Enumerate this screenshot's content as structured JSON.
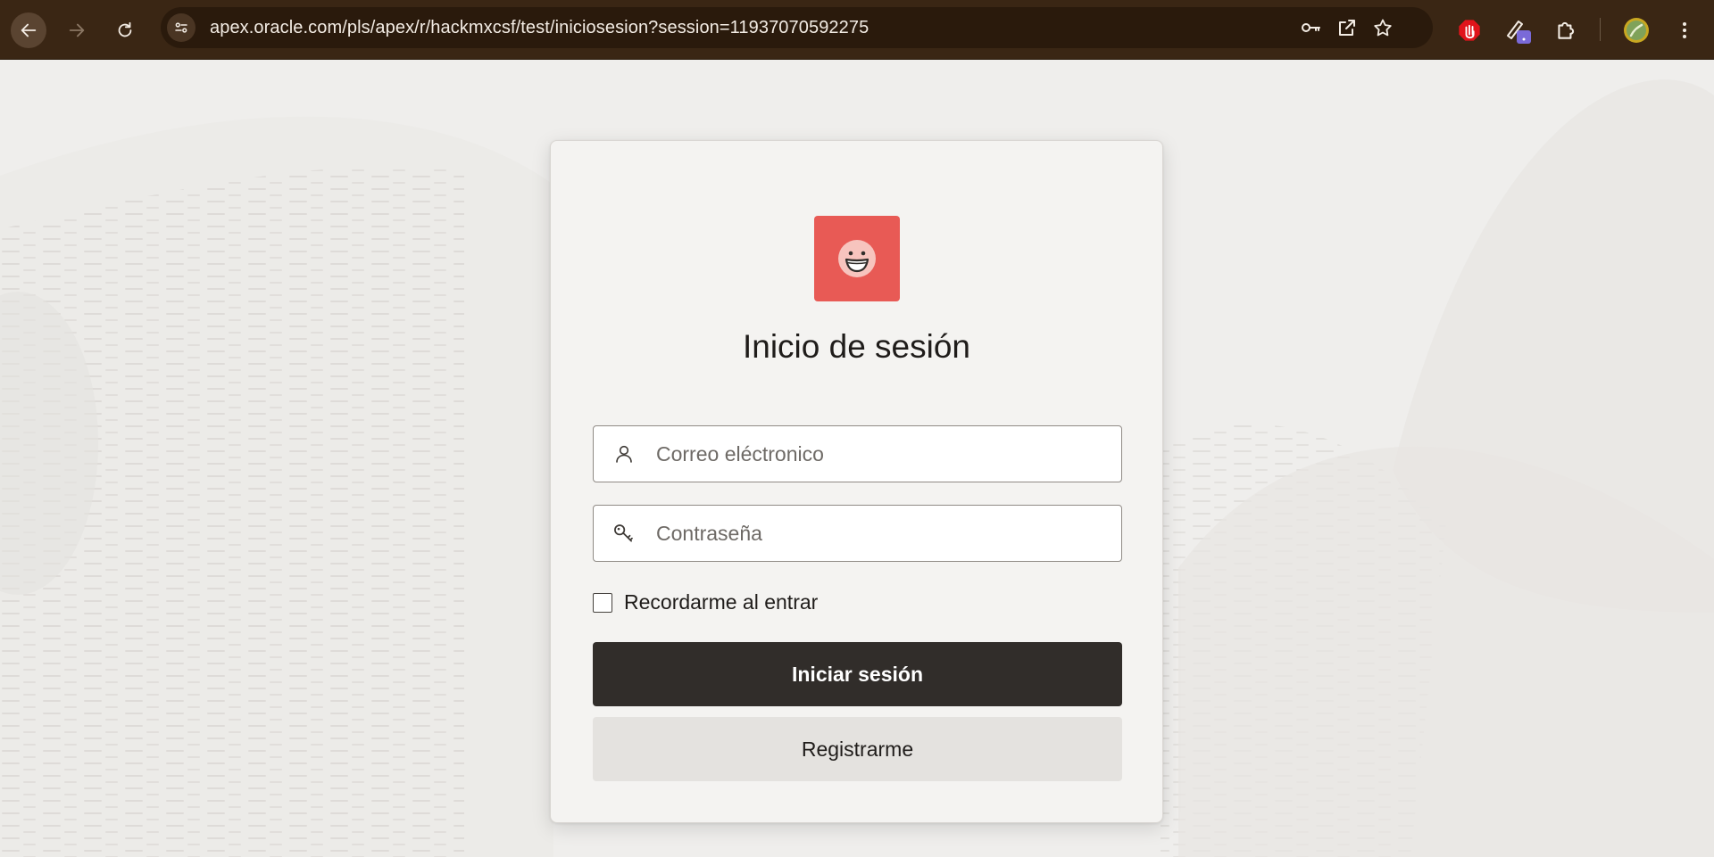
{
  "browser": {
    "url": "apex.oracle.com/pls/apex/r/hackmxcsf/test/iniciosesion?session=11937070592275",
    "nav": {
      "back_icon": "arrow-left-icon",
      "forward_icon": "arrow-right-icon",
      "reload_icon": "reload-icon"
    },
    "omnibox_icons": [
      "site-info-icon",
      "password-key-icon",
      "open-in-new-window-icon",
      "bookmark-star-icon"
    ],
    "toolbar_icons": [
      "adblock-hand-icon",
      "extension-pen-icon",
      "extensions-puzzle-icon",
      "profile-avatar-icon",
      "more-menu-icon"
    ],
    "colors": {
      "chrome_bg": "#3a2614",
      "omnibox_bg": "#2a1a0c",
      "text": "#f3ece4"
    }
  },
  "login": {
    "logo_icon": "smiley-face-icon",
    "title": "Inicio de sesión",
    "email": {
      "placeholder": "Correo eléctronico",
      "value": "",
      "icon": "user-icon"
    },
    "password": {
      "placeholder": "Contraseña",
      "value": "",
      "icon": "key-icon"
    },
    "remember_label": "Recordarme al entrar",
    "remember_checked": false,
    "submit_label": "Iniciar sesión",
    "register_label": "Registrarme",
    "colors": {
      "logo_bg": "#e85a55",
      "primary_button": "#312d2a",
      "secondary_button": "#e4e2df",
      "card_bg": "#f4f3f1",
      "page_bg": "#efeeec"
    }
  }
}
